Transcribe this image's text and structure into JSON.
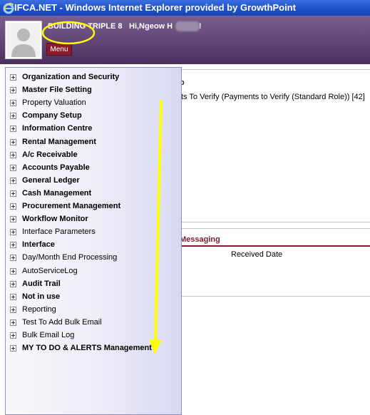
{
  "window": {
    "title": "IFCA.NET - Windows Internet Explorer provided by GrowthPoint",
    "ie_icon": "internet-explorer-icon"
  },
  "header": {
    "building": "BUILDING TRIPLE 8",
    "greeting": "Hi,Ngeow H",
    "greeting_tail": "n!",
    "menu_label": "Menu",
    "avatar_icon": "user-avatar-icon"
  },
  "background": {
    "panel_heading": "p",
    "todo_item": "ts To Verify (Payments to Verify (Standard Role)) [42]",
    "messaging_tab": "Messaging",
    "received_date_header": "Received Date"
  },
  "menu": {
    "items": [
      {
        "label": "Organization and Security",
        "bold": true
      },
      {
        "label": "Master File Setting",
        "bold": true
      },
      {
        "label": "Property Valuation",
        "bold": false
      },
      {
        "label": "Company Setup",
        "bold": true
      },
      {
        "label": "Information Centre",
        "bold": true
      },
      {
        "label": "Rental Management",
        "bold": true
      },
      {
        "label": "A/c Receivable",
        "bold": true
      },
      {
        "label": "Accounts Payable",
        "bold": true
      },
      {
        "label": "General Ledger",
        "bold": true
      },
      {
        "label": "Cash Management",
        "bold": true
      },
      {
        "label": "Procurement Management",
        "bold": true
      },
      {
        "label": "Workflow Monitor",
        "bold": true
      },
      {
        "label": "Interface Parameters",
        "bold": false
      },
      {
        "label": "Interface",
        "bold": true
      },
      {
        "label": "Day/Month End Processing",
        "bold": false
      },
      {
        "label": "AutoServiceLog",
        "bold": false
      },
      {
        "label": "Audit Trail",
        "bold": true
      },
      {
        "label": "Not in use",
        "bold": true
      },
      {
        "label": "Reporting",
        "bold": false
      },
      {
        "label": "Test To Add Bulk Email",
        "bold": false
      },
      {
        "label": "Bulk Email Log",
        "bold": false
      },
      {
        "label": "MY TO DO & ALERTS Management",
        "bold": true
      }
    ]
  },
  "colors": {
    "header_purple": "#5a3f6e",
    "menu_button_red": "#8a1c2c",
    "annotation_yellow": "#ffff00",
    "messaging_accent": "#7a1a2e"
  }
}
